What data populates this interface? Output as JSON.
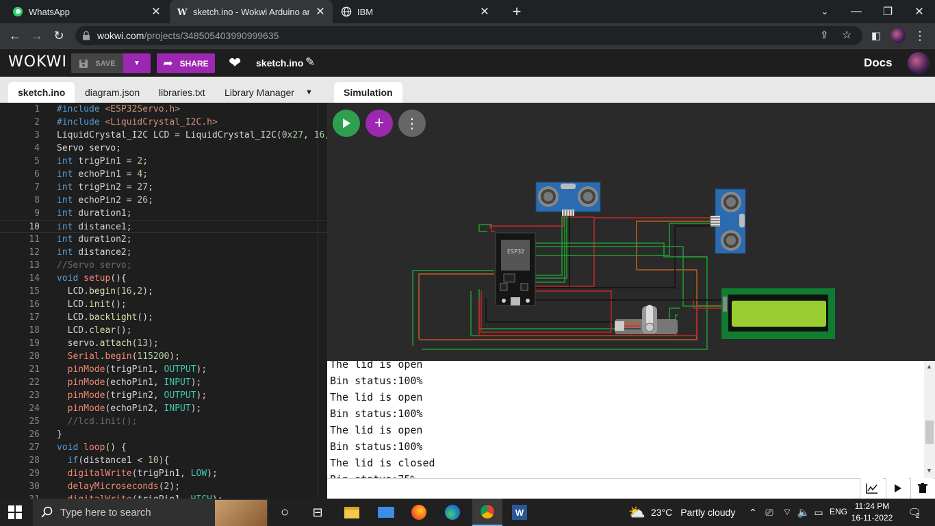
{
  "browser": {
    "tabs": [
      {
        "title": "WhatsApp",
        "active": false
      },
      {
        "title": "sketch.ino - Wokwi Arduino and I",
        "active": true
      },
      {
        "title": "IBM",
        "active": false
      }
    ],
    "url_host": "wokwi.com",
    "url_path": "/projects/348505403990999635"
  },
  "wokwi": {
    "logo": "WOKWI",
    "save_label": "SAVE",
    "share_label": "SHARE",
    "project_name": "sketch.ino",
    "docs_label": "Docs"
  },
  "editor_tabs": [
    "sketch.ino",
    "diagram.json",
    "libraries.txt",
    "Library Manager"
  ],
  "sim_tab": "Simulation",
  "code": {
    "current_line": 10,
    "first_line": 1
  },
  "serial": {
    "lines": [
      "The lid is open",
      "Bin status:100%",
      "The lid is open",
      "Bin status:100%",
      "The lid is open",
      "Bin status:100%",
      "The lid is closed",
      "Bin status:75%"
    ]
  },
  "components": {
    "mcu_label": "ESP32"
  },
  "taskbar": {
    "search_placeholder": "Type here to search",
    "weather_temp": "23°C",
    "weather_desc": "Partly cloudy",
    "lang": "ENG",
    "time": "11:24 PM",
    "date": "16-11-2022",
    "notifications": "2"
  },
  "colors": {
    "accent": "#9c27b0",
    "play": "#2e9e4f",
    "lcd_green": "#0f7d2f",
    "lcd_screen": "#9acd32"
  }
}
